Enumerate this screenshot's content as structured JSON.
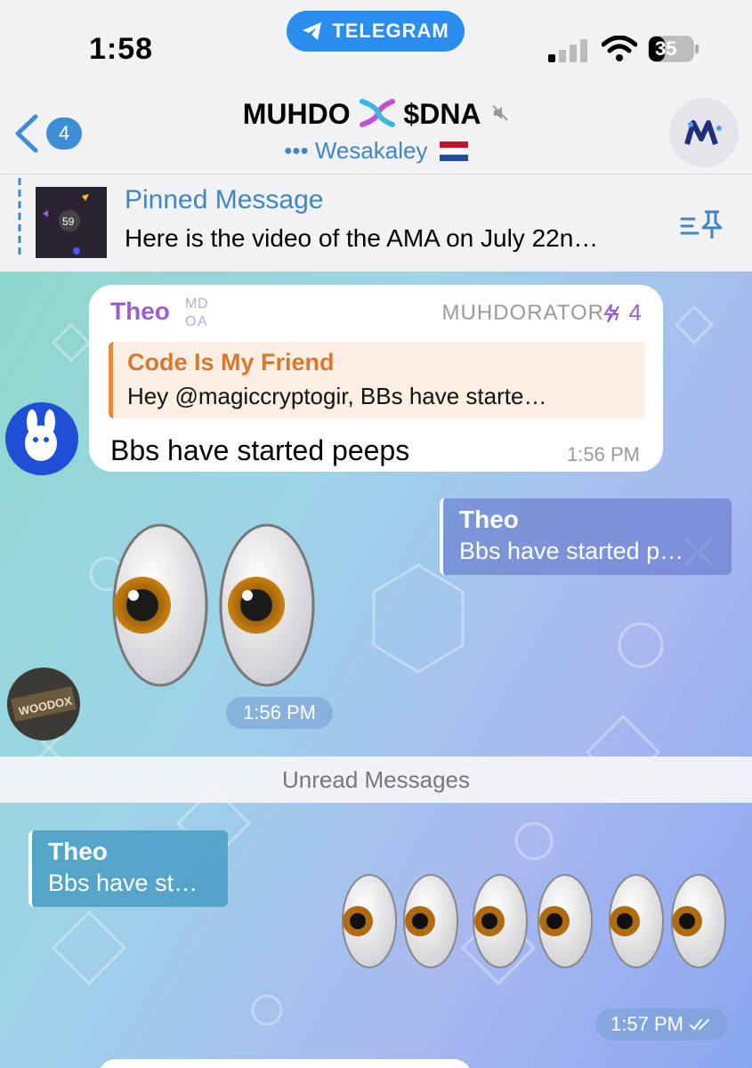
{
  "status_bar": {
    "time": "1:58",
    "app_pill": "TELEGRAM",
    "battery": "35"
  },
  "header": {
    "back_count": "4",
    "title_prefix": "MUHDO",
    "title_suffix": "$DNA",
    "subtitle": "Wesakaley",
    "typing_indicator": "•••"
  },
  "pinned": {
    "title": "Pinned Message",
    "text": "Here is the video of the AMA on July 22n…",
    "thumb_number": "59"
  },
  "messages": [
    {
      "sender": "Theo",
      "role": "MUHDORATOR",
      "boost": "4",
      "reply_to_name": "Code Is My Friend",
      "reply_to_text": "Hey @magiccryptogir, BBs have starte…",
      "text": "Bbs have started peeps",
      "time": "1:56 PM"
    },
    {
      "reply_to_name": "Theo",
      "reply_to_text": "Bbs have started p…",
      "time": "1:56 PM",
      "avatar_text": "WOODOX"
    },
    {
      "reply_to_name": "Theo",
      "reply_to_text": "Bbs have st…",
      "time": "1:57 PM"
    }
  ],
  "divider": "Unread Messages",
  "colors": {
    "accent": "#3e87c3",
    "pill": "#2a8ef0",
    "sender": "#9b5fd0",
    "reply_accent": "#d9782e"
  }
}
